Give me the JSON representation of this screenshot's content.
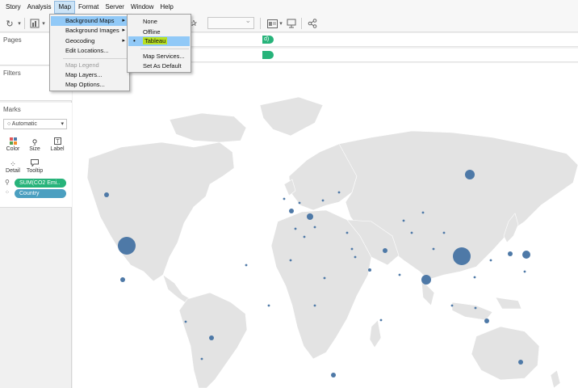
{
  "menubar": {
    "items": [
      "Story",
      "Analysis",
      "Map",
      "Format",
      "Server",
      "Window",
      "Help"
    ]
  },
  "left_pane": {
    "pages_title": "Pages",
    "filters_title": "Filters",
    "marks_title": "Marks",
    "mark_type": "Automatic",
    "buttons": {
      "color": "Color",
      "size": "Size",
      "label": "Label",
      "detail": "Detail",
      "tooltip": "Tooltip"
    },
    "pills": {
      "measure": "SUM(CO2 Emi..",
      "dimension": "Country"
    }
  },
  "shelves": {
    "pill_tail_1": "d)"
  },
  "map_menu": {
    "items": [
      {
        "label": "Background Maps",
        "submenu": true
      },
      {
        "label": "Background Images",
        "submenu": true
      },
      {
        "label": "Geocoding",
        "submenu": true
      },
      {
        "label": "Edit Locations..."
      },
      {
        "label": "Map Legend",
        "disabled": true
      },
      {
        "label": "Map Layers..."
      },
      {
        "label": "Map Options..."
      }
    ]
  },
  "background_maps_submenu": {
    "items": [
      "None",
      "Offline",
      "Tableau",
      "Map Services...",
      "Set As Default"
    ],
    "selected": "Tableau"
  },
  "map": {
    "land_color": "#e3e3e3",
    "border_color": "#ffffff",
    "mark_color": "#4e79a7",
    "bubbles": [
      {
        "country": "China",
        "size": 11
      },
      {
        "country": "United States",
        "size": 11
      },
      {
        "country": "India",
        "size": 6
      },
      {
        "country": "Russia",
        "size": 6
      },
      {
        "country": "Japan",
        "size": 5
      },
      {
        "country": "Germany",
        "size": 4
      },
      {
        "country": "Iran",
        "size": 3
      },
      {
        "country": "South Korea",
        "size": 3
      },
      {
        "country": "Saudi Arabia",
        "size": 2
      },
      {
        "country": "Canada",
        "size": 3
      },
      {
        "country": "Brazil",
        "size": 3
      },
      {
        "country": "Indonesia",
        "size": 3
      },
      {
        "country": "Mexico",
        "size": 3
      },
      {
        "country": "South Africa",
        "size": 3
      },
      {
        "country": "Australia",
        "size": 3
      },
      {
        "country": "United Kingdom",
        "size": 3
      }
    ]
  }
}
